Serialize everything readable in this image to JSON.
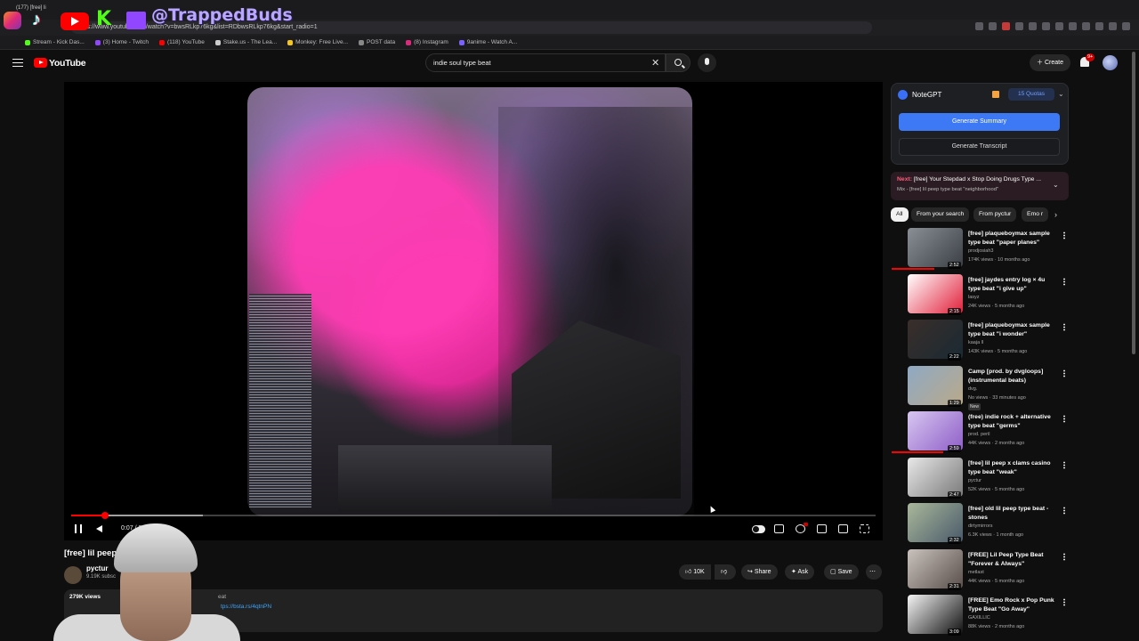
{
  "browser": {
    "tab_title": "(177) [free] li",
    "url": "https://www.youtube.com/watch?v=bwsRLkp76kg&list=RDbwsRLkp76kg&start_radio=1",
    "bookmarks": [
      {
        "label": "Stream - Kick Das...",
        "color": "#53fc18"
      },
      {
        "label": "(3) Home - Twitch",
        "color": "#9146ff"
      },
      {
        "label": "(118) YouTube",
        "color": "#ff0000"
      },
      {
        "label": "Stake.us - The Lea...",
        "color": "#cccccc"
      },
      {
        "label": "Monkey: Free Live...",
        "color": "#f5c518"
      },
      {
        "label": "POST data",
        "color": "#888888"
      },
      {
        "label": "(8) Instagram",
        "color": "#dd2a7b"
      },
      {
        "label": "9anime - Watch A...",
        "color": "#7b61ff"
      }
    ]
  },
  "overlay": {
    "handle": "@TrappedBuds",
    "kick_letter": "K"
  },
  "youtube": {
    "logo_text": "YouTube",
    "search_value": "indie soul type beat",
    "create_label": "Create",
    "notif_badge": "9+"
  },
  "player": {
    "progress": 0.042,
    "buffered": 0.164,
    "time": "0:07 / 3:",
    "colors": {
      "accent": "#ff0000"
    }
  },
  "video": {
    "title": "[free] lil peep t                   rhood\"",
    "channel": "pyctur",
    "subs": "9.19K subsc",
    "likes": "10K",
    "share": "Share",
    "ask": "Ask",
    "save": "Save",
    "desc_views": "279K views",
    "desc_tags": "eat",
    "desc_link": "tps://bsta.rs/4qtnPN"
  },
  "notegpt": {
    "title": "NoteGPT",
    "quota": "15 Quotas",
    "summary_label": "Generate Summary",
    "transcript_label": "Generate Transcript"
  },
  "next": {
    "label": "Next:",
    "title": "[free] Your Stepdad x Stop Doing Drugs Type ...",
    "sub": "Mix - [free] lil peep type beat \"neighborhood\""
  },
  "chips": [
    "All",
    "From your search",
    "From pyctur",
    "Emo r"
  ],
  "recs": [
    {
      "title": "[free] plaqueboymax sample type beat \"paper planes\"",
      "channel": "prodjosiah3",
      "meta": "174K views · 10 months ago",
      "duration": "2:52",
      "watched": 0.6,
      "new": "",
      "colors": [
        "#8a8f96",
        "#3b3f45"
      ]
    },
    {
      "title": "[free] jaydes entry log × 4u type beat \"i give up\"",
      "channel": "lasyz",
      "meta": "24K views · 5 months ago",
      "duration": "2:15",
      "watched": 0,
      "new": "",
      "colors": [
        "#ffffff",
        "#e0203a"
      ]
    },
    {
      "title": "[free] plaqueboymax sample type beat \"i wonder\"",
      "channel": "kaaja ll",
      "meta": "143K views · 5 months ago",
      "duration": "2:22",
      "watched": 0,
      "new": "",
      "colors": [
        "#3a2e2a",
        "#1a2a33"
      ]
    },
    {
      "title": "Camp [prod. by dvgloops] (instrumental beats)",
      "channel": "dvg.",
      "meta": "No views · 33 minutes ago",
      "duration": "1:29",
      "watched": 0,
      "new": "New",
      "colors": [
        "#8fa9c4",
        "#b9a98a"
      ]
    },
    {
      "title": "(free) indie rock + alternative type beat \"germs\"",
      "channel": "prod. peril",
      "meta": "44K views · 2 months ago",
      "duration": "2:59",
      "watched": 0.72,
      "new": "",
      "colors": [
        "#d7c6f0",
        "#8f5fc8"
      ]
    },
    {
      "title": "[free] lil peep x clams casino type beat \"weak\"",
      "channel": "pyctur",
      "meta": "52K views · 5 months ago",
      "duration": "2:47",
      "watched": 0,
      "new": "",
      "colors": [
        "#e8e8e8",
        "#7a7a7a"
      ]
    },
    {
      "title": "[free] old lil peep type beat - stones",
      "channel": "dirtymirrors",
      "meta": "6.3K views · 1 month ago",
      "duration": "2:32",
      "watched": 0,
      "new": "",
      "colors": [
        "#a9b89a",
        "#4a5a6a"
      ]
    },
    {
      "title": "[FREE] Lil Peep Type Beat \"Forever & Always\"",
      "channel": "metlast",
      "meta": "44K views · 5 months ago",
      "duration": "2:31",
      "watched": 0,
      "new": "",
      "colors": [
        "#c9c2bd",
        "#5a4f4a"
      ]
    },
    {
      "title": "[FREE] Emo Rock x Pop Punk Type Beat \"Go Away\"",
      "channel": "GAXILLIC",
      "meta": "88K views · 2 months ago",
      "duration": "3:09",
      "watched": 0,
      "new": "",
      "colors": [
        "#f5f5f5",
        "#111111"
      ]
    }
  ]
}
